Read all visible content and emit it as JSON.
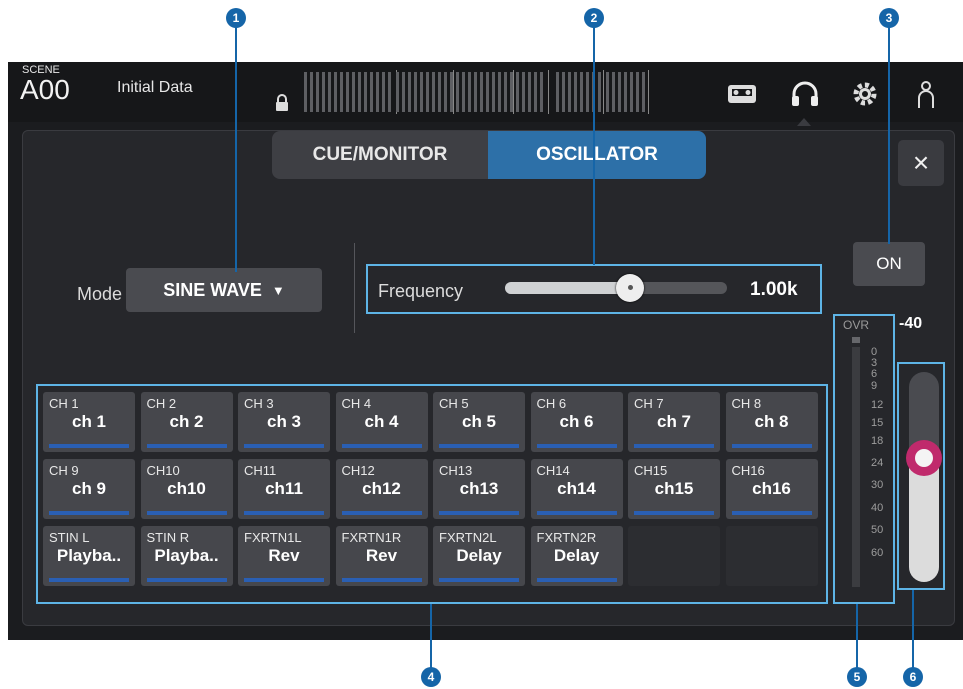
{
  "scene": {
    "label": "SCENE",
    "number": "A00",
    "name": "Initial Data"
  },
  "tabs": {
    "cue_monitor": "CUE/MONITOR",
    "oscillator": "OSCILLATOR"
  },
  "close_label": "×",
  "mode": {
    "label": "Mode",
    "value": "SINE WAVE",
    "arrow": "▼"
  },
  "frequency": {
    "label": "Frequency",
    "value": "1.00k",
    "slider_fraction": 0.56
  },
  "on_button": "ON",
  "level": "-40",
  "meter": {
    "ovr": "OVR",
    "ticks": [
      "0",
      "3",
      "6",
      "9",
      "12",
      "15",
      "18",
      "24",
      "30",
      "40",
      "50",
      "60"
    ]
  },
  "fader_fraction": 0.58,
  "callouts": [
    "1",
    "2",
    "3",
    "4",
    "5",
    "6"
  ],
  "channels": [
    {
      "ch": "CH 1",
      "name": "ch 1"
    },
    {
      "ch": "CH 2",
      "name": "ch 2"
    },
    {
      "ch": "CH 3",
      "name": "ch 3"
    },
    {
      "ch": "CH 4",
      "name": "ch 4"
    },
    {
      "ch": "CH 5",
      "name": "ch 5"
    },
    {
      "ch": "CH 6",
      "name": "ch 6"
    },
    {
      "ch": "CH 7",
      "name": "ch 7"
    },
    {
      "ch": "CH 8",
      "name": "ch 8"
    },
    {
      "ch": "CH 9",
      "name": "ch 9"
    },
    {
      "ch": "CH10",
      "name": "ch10"
    },
    {
      "ch": "CH11",
      "name": "ch11"
    },
    {
      "ch": "CH12",
      "name": "ch12"
    },
    {
      "ch": "CH13",
      "name": "ch13"
    },
    {
      "ch": "CH14",
      "name": "ch14"
    },
    {
      "ch": "CH15",
      "name": "ch15"
    },
    {
      "ch": "CH16",
      "name": "ch16"
    },
    {
      "ch": "STIN L",
      "name": "Playba.."
    },
    {
      "ch": "STIN R",
      "name": "Playba.."
    },
    {
      "ch": "FXRTN1L",
      "name": "Rev"
    },
    {
      "ch": "FXRTN1R",
      "name": "Rev"
    },
    {
      "ch": "FXRTN2L",
      "name": "Delay"
    },
    {
      "ch": "FXRTN2R",
      "name": "Delay"
    }
  ],
  "icons": [
    "lock-icon",
    "recorder-icon",
    "headphones-icon",
    "gear-icon",
    "user-icon",
    "close-icon",
    "dropdown-arrow-icon"
  ],
  "colors": {
    "accent_blue": "#2d70a8",
    "callout_blue": "#1565a8",
    "highlight": "#5eb4e6",
    "fader_knob": "#c02a6c",
    "channel_bar": "#2a5fb3"
  }
}
